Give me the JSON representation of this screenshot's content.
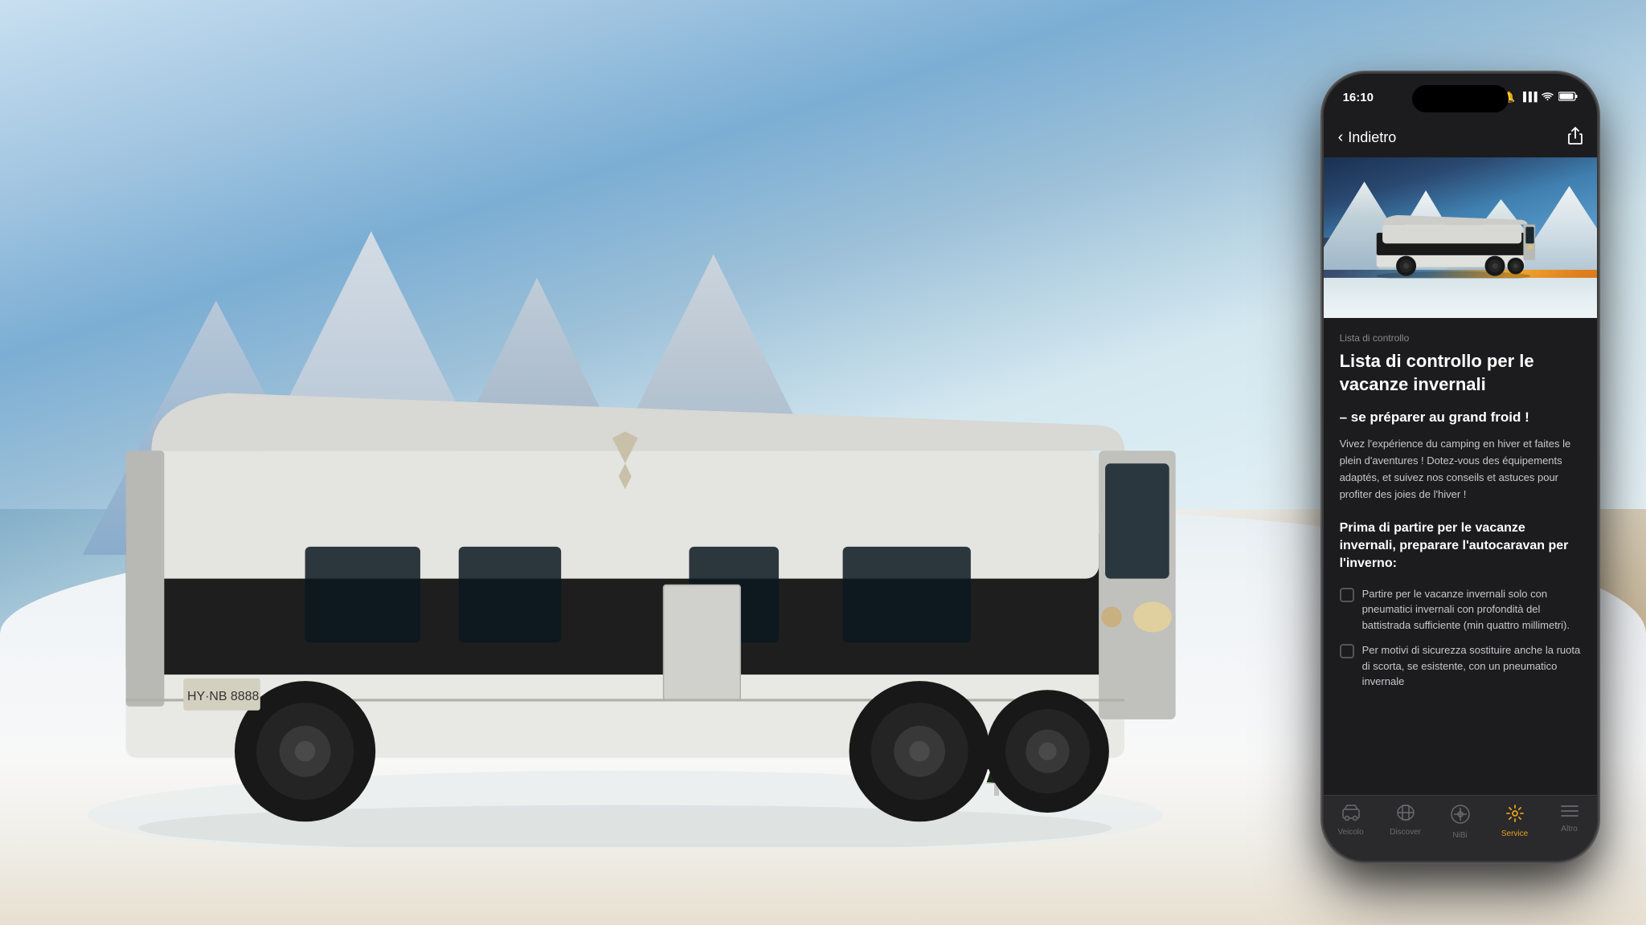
{
  "background": {
    "alt": "Winter landscape with RV"
  },
  "phone": {
    "statusBar": {
      "time": "16:10",
      "bell": "🔔",
      "signal": "▐▐▐",
      "wifi": "▲",
      "battery": "▐▐▐▐"
    },
    "navHeader": {
      "backLabel": "Indietro",
      "shareIcon": "⬆"
    },
    "heroImage": {
      "alt": "RV in winter mountain landscape"
    },
    "content": {
      "label": "Lista di controllo",
      "title": "Lista di controllo per le vacanze invernali",
      "subtitle": "– se préparer au grand froid !",
      "bodyText": "Vivez l'expérience du camping en hiver et faites le plein d'aventures ! Dotez-vous des équipements adaptés, et suivez nos conseils et astuces pour profiter des joies de l'hiver !",
      "sectionTitle": "Prima di partire per le vacanze invernali, preparare l'autocaravan per l'inverno:",
      "checklistItems": [
        {
          "text": "Partire per le vacanze invernali solo con pneumatici invernali con profondità del battistrada sufficiente (min quattro millimetri)."
        },
        {
          "text": "Per motivi di sicurezza sostituire anche la ruota di scorta, se esistente, con un pneumatico invernale"
        }
      ]
    },
    "tabBar": {
      "tabs": [
        {
          "icon": "🚌",
          "label": "Veicolo",
          "active": false
        },
        {
          "icon": "🔭",
          "label": "Discover",
          "active": false
        },
        {
          "icon": "⊕",
          "label": "NiBi",
          "active": false
        },
        {
          "icon": "⚙",
          "label": "Service",
          "active": true
        },
        {
          "icon": "≡",
          "label": "Altro",
          "active": false
        }
      ]
    }
  },
  "colors": {
    "accent": "#e8a020",
    "bgDark": "#1c1c1e",
    "tabBarBg": "#2a2a2c",
    "textPrimary": "#ffffff",
    "textSecondary": "#c8c8cc",
    "textMuted": "#8a8a8e"
  }
}
